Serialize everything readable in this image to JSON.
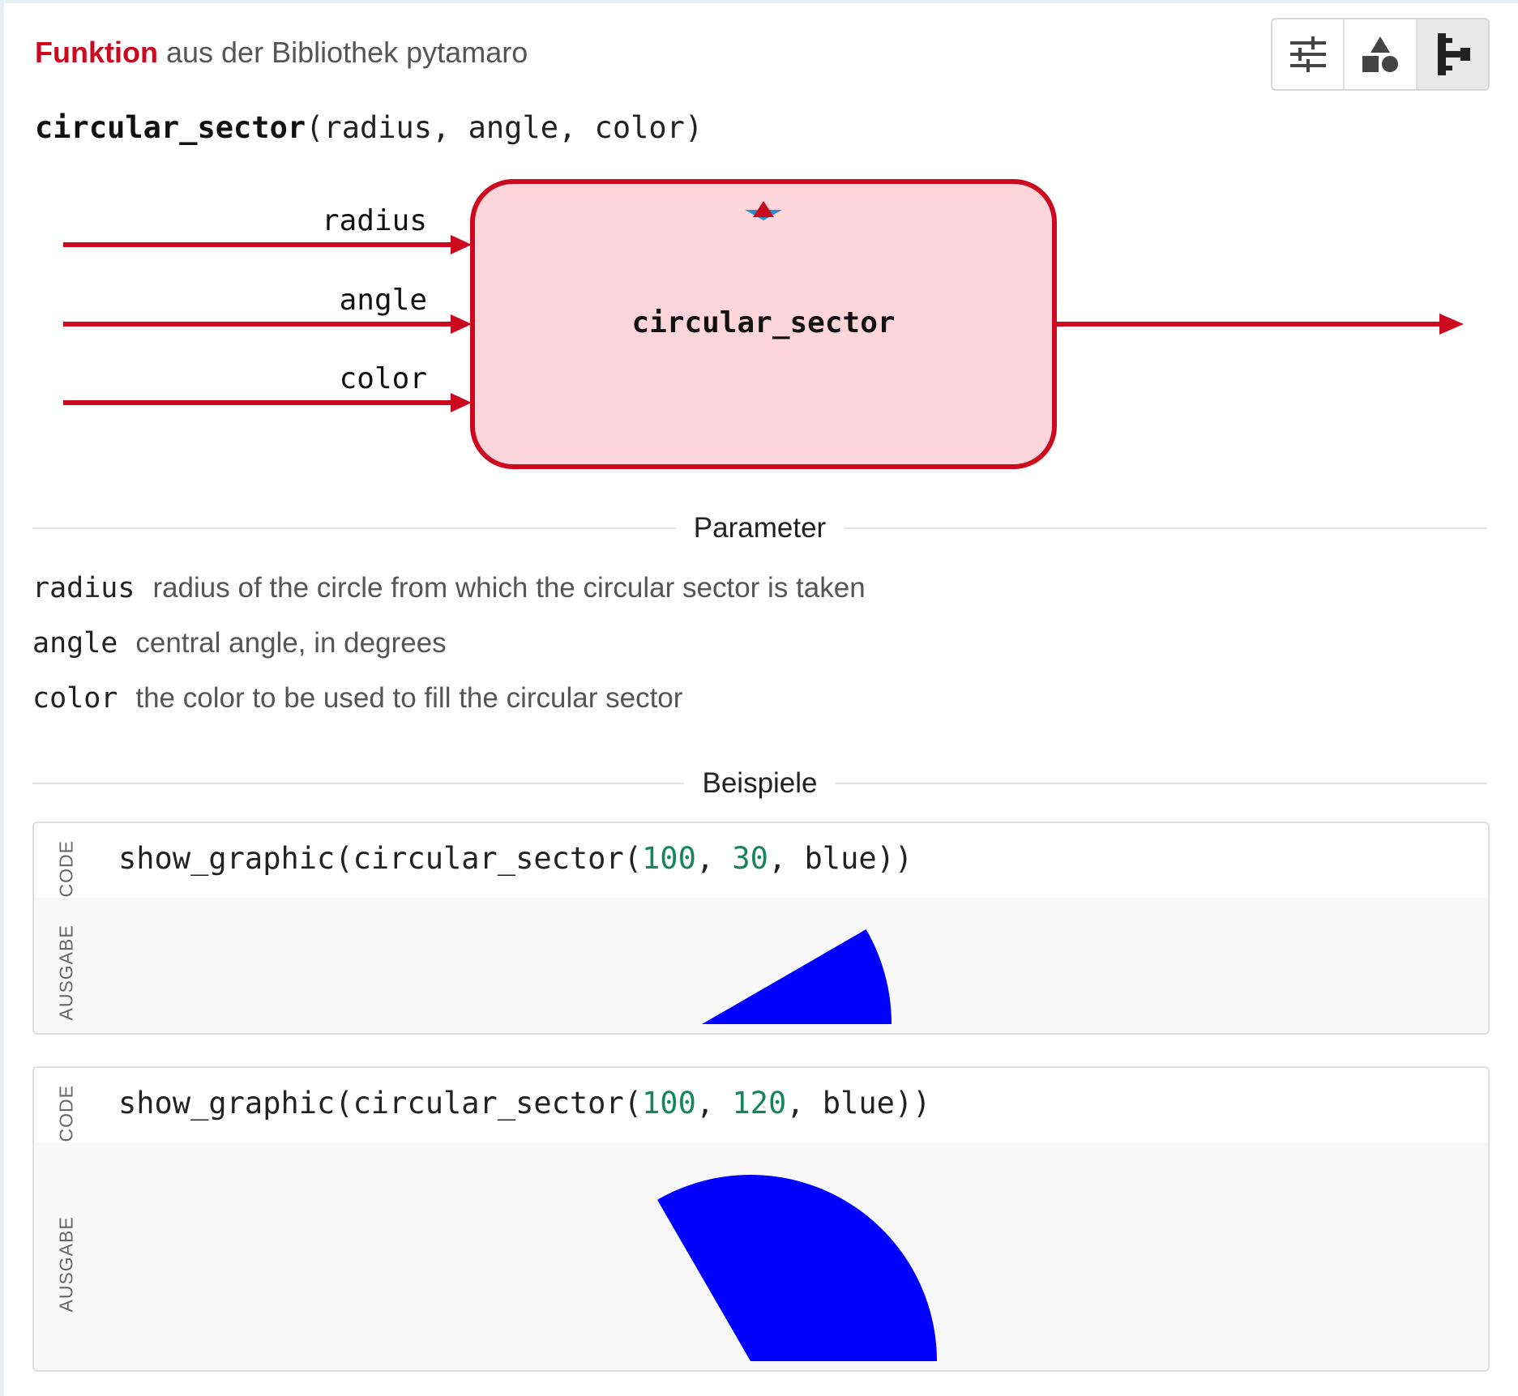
{
  "header": {
    "kind": "Funktion",
    "source": "aus der Bibliothek pytamaro"
  },
  "toolbar": {
    "buttons": [
      {
        "icon": "sliders-icon",
        "active": false
      },
      {
        "icon": "shapes-icon",
        "active": false
      },
      {
        "icon": "tree-diagram-icon",
        "active": true
      }
    ]
  },
  "signature": {
    "name": "circular_sector",
    "open": "(",
    "params": "radius, angle, color",
    "close": ")"
  },
  "diagram": {
    "function_name": "circular_sector",
    "inputs": [
      "radius",
      "angle",
      "color"
    ],
    "colors": {
      "stroke": "#cc0a1f",
      "fill": "#fdd5da",
      "marker_blue": "#2a8ec8"
    }
  },
  "parameters": {
    "title": "Parameter",
    "items": [
      {
        "name": "radius",
        "description": "radius of the circle from which the circular sector is taken"
      },
      {
        "name": "angle",
        "description": "central angle, in degrees"
      },
      {
        "name": "color",
        "description": "the color to be used to fill the circular sector"
      }
    ]
  },
  "examples": {
    "title": "Beispiele",
    "code_label": "CODE",
    "output_label": "AUSGABE",
    "items": [
      {
        "prefix": "show_graphic(circular_sector(",
        "arg1": "100",
        "sep1": ", ",
        "arg2": "30",
        "sep2": ", ",
        "suffix": "blue))",
        "radius": 100,
        "angle": 30,
        "color": "#0000ff"
      },
      {
        "prefix": "show_graphic(circular_sector(",
        "arg1": "100",
        "sep1": ", ",
        "arg2": "120",
        "sep2": ", ",
        "suffix": "blue))",
        "radius": 100,
        "angle": 120,
        "color": "#0000ff"
      }
    ]
  }
}
